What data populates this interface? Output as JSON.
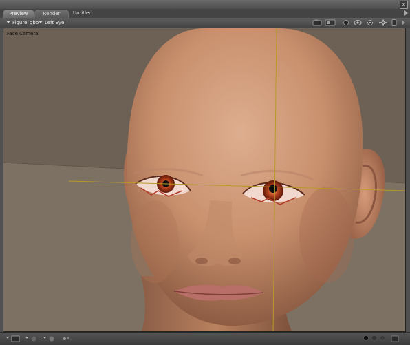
{
  "window": {
    "close_glyph": "×",
    "tabs": [
      {
        "label": "Preview",
        "active": true
      },
      {
        "label": "Render",
        "active": false
      }
    ],
    "doc_title": "Untitled"
  },
  "toolbar": {
    "figure_select": "Figure_gbp",
    "element_select": "Left Eye",
    "icons": [
      "camera-icon",
      "display-icon",
      "light-icon",
      "rotate-icon",
      "gear-icon",
      "move-icon",
      "viewport-options-icon"
    ]
  },
  "viewport": {
    "camera_label": "Face Camera"
  },
  "bottombar": {
    "left_icons": [
      "layout-menu-icon",
      "render-style-menu-icon",
      "lighting-menu-icon",
      "texture-menu-icon"
    ],
    "right_icons": [
      "preview-dot-icon",
      "preview-dot-icon",
      "preview-dot-icon",
      "resize-grip-icon"
    ]
  }
}
